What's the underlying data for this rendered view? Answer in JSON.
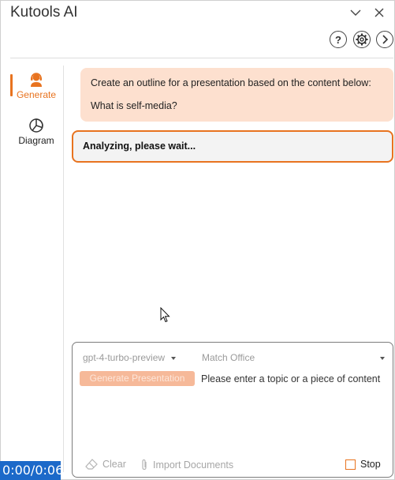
{
  "window": {
    "title": "Kutools AI"
  },
  "icons": {
    "minimize": "chevron-down-icon",
    "close": "close-icon",
    "help": "question-icon",
    "settings": "gear-icon",
    "collapse": "chevron-right-icon",
    "generate": "support-agent-icon",
    "diagram": "pie-chart-icon",
    "clear": "eraser-icon",
    "import": "paperclip-icon"
  },
  "sidebar": {
    "items": [
      {
        "label": "Generate",
        "active": true
      },
      {
        "label": "Diagram",
        "active": false
      }
    ]
  },
  "conversation": {
    "user_message": {
      "line1": "Create an outline for a presentation based on the content below:",
      "line2": "What is self-media?"
    },
    "ai_message": "Analyzing, please wait..."
  },
  "composer": {
    "model": "gpt-4-turbo-preview",
    "template": "Match Office",
    "generate_button": "Generate Presentation",
    "placeholder": "Please enter a topic or a piece of content",
    "clear_label": "Clear",
    "import_label": "Import Documents",
    "stop_label": "Stop"
  },
  "video_timer": "0:00/0:06",
  "colors": {
    "accent": "#e8731f",
    "user_bubble": "#fde0cf",
    "ai_bubble": "#f3f3f3",
    "disabled_button": "#f6b999",
    "timer_bg": "#1c69c9"
  }
}
